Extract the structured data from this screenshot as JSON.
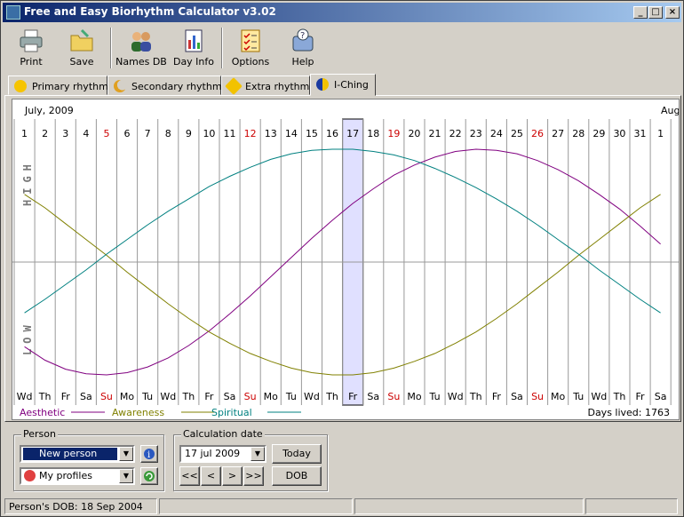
{
  "window": {
    "title": "Free and Easy Biorhythm Calculator v3.02"
  },
  "toolbar": {
    "print": "Print",
    "save": "Save",
    "names_db": "Names DB",
    "day_info": "Day Info",
    "options": "Options",
    "help": "Help"
  },
  "tabs": [
    {
      "label": "Primary rhythms",
      "icon": "sun-icon"
    },
    {
      "label": "Secondary rhythms",
      "icon": "moon-icon"
    },
    {
      "label": "Extra rhythms",
      "icon": "star-icon"
    },
    {
      "label": "I-Ching",
      "icon": "yin-yang-icon"
    }
  ],
  "chart": {
    "month_left": "July, 2009",
    "month_right": "Aug",
    "high_label": "HIGH",
    "low_label": "LOW",
    "days_lived": "Days lived: 1763",
    "selected_day": 17,
    "colors": {
      "aesthetic": "#800080",
      "awareness": "#808000",
      "spiritual": "#008080",
      "weekend": "#cc0000",
      "highlight": "#e0e0ff"
    }
  },
  "chart_data": {
    "type": "line",
    "x": [
      1,
      2,
      3,
      4,
      5,
      6,
      7,
      8,
      9,
      10,
      11,
      12,
      13,
      14,
      15,
      16,
      17,
      18,
      19,
      20,
      21,
      22,
      23,
      24,
      25,
      26,
      27,
      28,
      29,
      30,
      31,
      1
    ],
    "weekdays": [
      "Wd",
      "Th",
      "Fr",
      "Sa",
      "Su",
      "Mo",
      "Tu",
      "Wd",
      "Th",
      "Fr",
      "Sa",
      "Su",
      "Mo",
      "Tu",
      "Wd",
      "Th",
      "Fr",
      "Sa",
      "Su",
      "Mo",
      "Tu",
      "Wd",
      "Th",
      "Fr",
      "Sa",
      "Su",
      "Mo",
      "Tu",
      "Wd",
      "Th",
      "Fr",
      "Sa"
    ],
    "ylim": [
      -1,
      1
    ],
    "series": [
      {
        "name": "Aesthetic",
        "values": [
          -0.75,
          -0.87,
          -0.95,
          -0.99,
          -1.0,
          -0.98,
          -0.93,
          -0.85,
          -0.74,
          -0.61,
          -0.46,
          -0.3,
          -0.13,
          0.04,
          0.21,
          0.37,
          0.52,
          0.65,
          0.77,
          0.86,
          0.93,
          0.98,
          1.0,
          0.99,
          0.96,
          0.9,
          0.82,
          0.72,
          0.6,
          0.47,
          0.32,
          0.16
        ]
      },
      {
        "name": "Awareness",
        "values": [
          0.6,
          0.48,
          0.34,
          0.2,
          0.06,
          -0.09,
          -0.23,
          -0.37,
          -0.5,
          -0.62,
          -0.72,
          -0.81,
          -0.88,
          -0.94,
          -0.98,
          -1.0,
          -1.0,
          -0.98,
          -0.94,
          -0.88,
          -0.81,
          -0.72,
          -0.62,
          -0.5,
          -0.37,
          -0.23,
          -0.09,
          0.06,
          0.2,
          0.34,
          0.48,
          0.6
        ]
      },
      {
        "name": "Spiritual",
        "values": [
          -0.45,
          -0.33,
          -0.2,
          -0.07,
          0.07,
          0.2,
          0.33,
          0.45,
          0.56,
          0.67,
          0.76,
          0.84,
          0.91,
          0.96,
          0.99,
          1.0,
          1.0,
          0.98,
          0.95,
          0.9,
          0.83,
          0.75,
          0.66,
          0.56,
          0.45,
          0.33,
          0.2,
          0.07,
          -0.07,
          -0.2,
          -0.33,
          -0.45
        ]
      }
    ]
  },
  "person": {
    "group_label": "Person",
    "current": "New person",
    "profiles": "My profiles"
  },
  "calc": {
    "group_label": "Calculation date",
    "date": "17  jul  2009",
    "today": "Today",
    "dob": "DOB",
    "nav": [
      "<<",
      "<",
      ">",
      ">>"
    ]
  },
  "status": {
    "dob": "Person's DOB: 18 Sep 2004"
  }
}
